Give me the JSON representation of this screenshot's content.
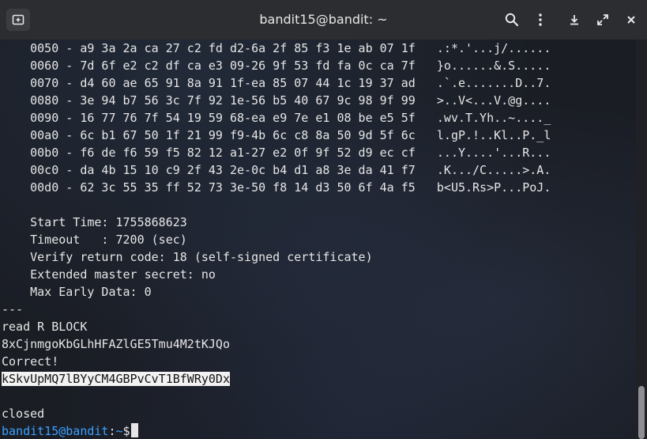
{
  "window": {
    "title": "bandit15@bandit: ~"
  },
  "icons": {
    "new_tab": "new-tab-icon",
    "search": "search-icon",
    "menu": "kebab-menu-icon",
    "minimize": "minimize-icon",
    "maximize": "maximize-icon",
    "close": "close-icon"
  },
  "terminal": {
    "hex_lines": [
      "    0050 - a9 3a 2a ca 27 c2 fd d2-6a 2f 85 f3 1e ab 07 1f   .:*.'...j/......",
      "    0060 - 7d 6f e2 c2 df ca e3 09-26 9f 53 fd fa 0c ca 7f   }o......&.S.....",
      "    0070 - d4 60 ae 65 91 8a 91 1f-ea 85 07 44 1c 19 37 ad   .`.e.......D..7.",
      "    0080 - 3e 94 b7 56 3c 7f 92 1e-56 b5 40 67 9c 98 9f 99   >..V<...V.@g....",
      "    0090 - 16 77 76 7f 54 19 59 68-ea e9 7e e1 08 be e5 5f   .wv.T.Yh..~...._",
      "    00a0 - 6c b1 67 50 1f 21 99 f9-4b 6c c8 8a 50 9d 5f 6c   l.gP.!..Kl..P._l",
      "    00b0 - f6 de f6 59 f5 82 12 a1-27 e2 0f 9f 52 d9 ec cf   ...Y....'...R...",
      "    00c0 - da 4b 15 10 c9 2f 43 2e-0c b4 d1 a8 3e da 41 f7   .K.../C.....>.A.",
      "    00d0 - 62 3c 55 35 ff 52 73 3e-50 f8 14 d3 50 6f 4a f5   b<U5.Rs>P...PoJ."
    ],
    "session_lines": [
      "",
      "    Start Time: 1755868623",
      "    Timeout   : 7200 (sec)",
      "    Verify return code: 18 (self-signed certificate)",
      "    Extended master secret: no",
      "    Max Early Data: 0",
      "---",
      "read R BLOCK",
      "8xCjnmgoKbGLhHFAZlGE5Tmu4M2tKJQo",
      "Correct!"
    ],
    "password_line": "kSkvUpMQ7lBYyCM4GBPvCvT1BfWRy0Dx",
    "blank_line": "",
    "closed_line": "closed",
    "prompt": {
      "user_host": "bandit15@bandit",
      "sep": ":",
      "path": "~",
      "symbol": "$"
    }
  },
  "colors": {
    "prompt": "#3aa0ff",
    "highlight_bg": "#f2f2f2",
    "text": "#e6e6e6"
  }
}
